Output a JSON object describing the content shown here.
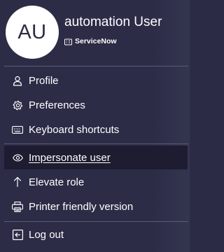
{
  "user": {
    "initials": "AU",
    "name": "automation User",
    "company": "ServiceNow"
  },
  "menu": {
    "items": [
      {
        "label": "Profile",
        "icon": "person-icon"
      },
      {
        "label": "Preferences",
        "icon": "gear-icon"
      },
      {
        "label": "Keyboard shortcuts",
        "icon": "keyboard-icon"
      },
      {
        "label": "Impersonate user",
        "icon": "eye-icon",
        "active": true
      },
      {
        "label": "Elevate role",
        "icon": "arrow-up-icon"
      },
      {
        "label": "Printer friendly version",
        "icon": "printer-icon"
      }
    ],
    "logout": {
      "label": "Log out",
      "icon": "logout-icon"
    }
  },
  "colors": {
    "panel_bg": "#2c2c47",
    "active_item_bg": "#1d1c30",
    "avatar_bg": "#ffffff",
    "avatar_text": "#2b2b45",
    "divider": "#5a5b78"
  }
}
